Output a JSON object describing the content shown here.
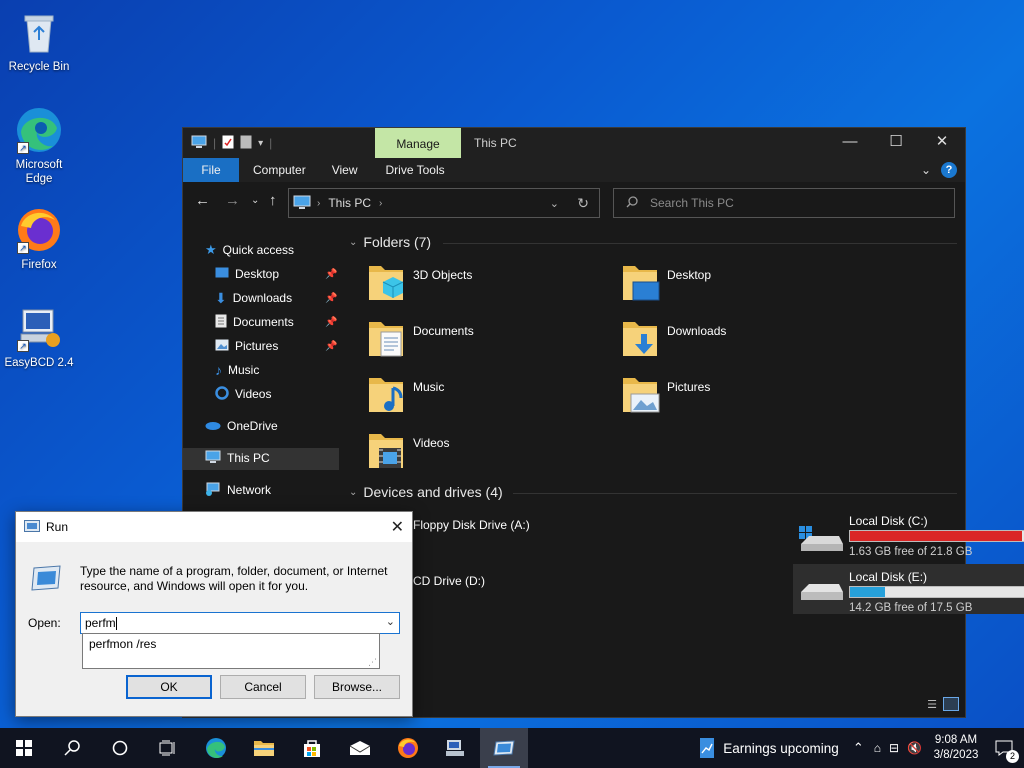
{
  "desktop": {
    "icons": [
      {
        "label": "Recycle Bin",
        "icon": "recycle-bin-icon"
      },
      {
        "label": "Microsoft Edge",
        "icon": "edge-icon"
      },
      {
        "label": "Firefox",
        "icon": "firefox-icon"
      },
      {
        "label": "EasyBCD 2.4",
        "icon": "easybcd-icon"
      }
    ]
  },
  "explorer": {
    "title": "This PC",
    "manage_tab": "Manage",
    "ribbon_tabs": [
      "File",
      "Computer",
      "View",
      "Drive Tools"
    ],
    "address": {
      "location": "This PC"
    },
    "search": {
      "placeholder": "Search This PC"
    },
    "sidebar": {
      "quick_access": "Quick access",
      "items": [
        "Desktop",
        "Downloads",
        "Documents",
        "Pictures",
        "Music",
        "Videos"
      ],
      "onedrive": "OneDrive",
      "this_pc": "This PC",
      "network": "Network"
    },
    "folders_header": "Folders (7)",
    "folders": [
      "3D Objects",
      "Desktop",
      "Documents",
      "Downloads",
      "Music",
      "Pictures",
      "Videos"
    ],
    "devices_header": "Devices and drives (4)",
    "drives": [
      {
        "name": "Floppy Disk Drive (A:)"
      },
      {
        "name": "Local Disk (C:)",
        "free": "1.63 GB free of 21.8 GB",
        "used_fraction": 0.925,
        "color": "#da2626"
      },
      {
        "name": "CD Drive (D:)"
      },
      {
        "name": "Local Disk (E:)",
        "free": "14.2 GB free of 17.5 GB",
        "used_fraction": 0.19,
        "color": "#26a0da"
      }
    ]
  },
  "run_dialog": {
    "title": "Run",
    "description": "Type the name of a program, folder, document, or Internet resource, and Windows will open it for you.",
    "open_label": "Open:",
    "input_value": "perfm",
    "suggestion": "perfmon /res",
    "ok": "OK",
    "cancel": "Cancel",
    "browse": "Browse..."
  },
  "taskbar": {
    "news": "Earnings upcoming",
    "time": "9:08 AM",
    "date": "3/8/2023",
    "notification_count": "2"
  }
}
